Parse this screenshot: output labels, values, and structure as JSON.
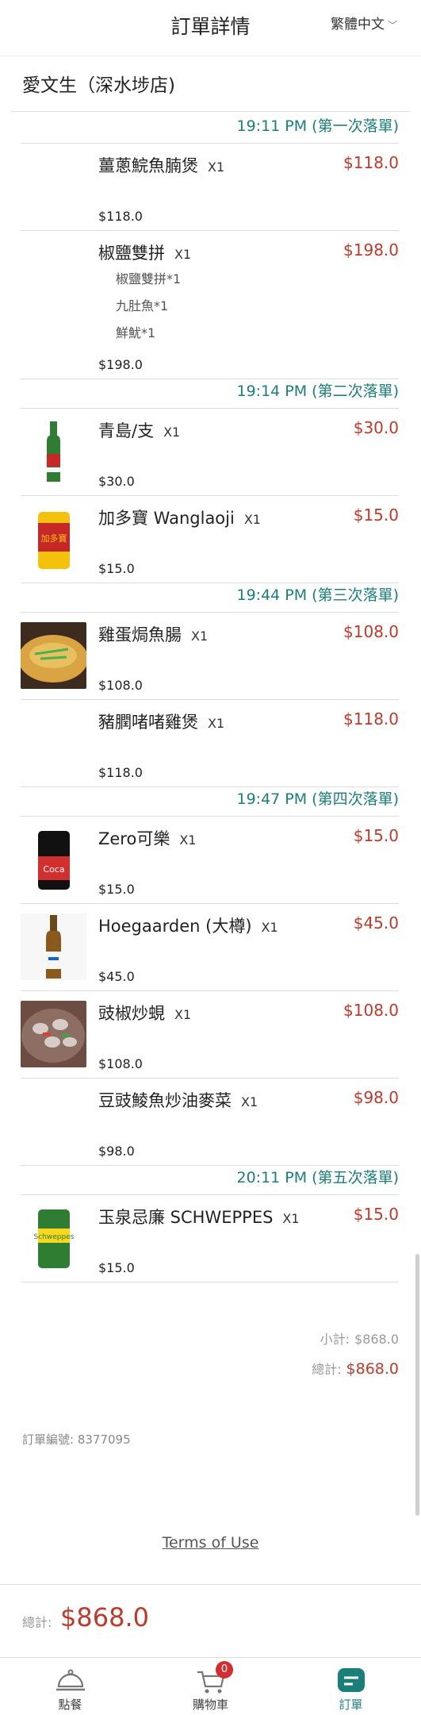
{
  "header": {
    "title": "訂單詳情",
    "language": "繁體中文"
  },
  "store": {
    "name": "愛文生（深水埗店)"
  },
  "rounds": [
    {
      "time": "19:11 PM (第一次落單)",
      "items": [
        {
          "name": "薑蔥鯇魚腩煲",
          "qty": "X1",
          "price": "$118.0",
          "subtotal": "$118.0",
          "image": "none",
          "options": []
        },
        {
          "name": "椒鹽雙拼",
          "qty": "X1",
          "price": "$198.0",
          "subtotal": "$198.0",
          "image": "none",
          "options": [
            "椒鹽雙拼*1",
            "九肚魚*1",
            "鮮魷*1"
          ]
        }
      ]
    },
    {
      "time": "19:14 PM (第二次落單)",
      "items": [
        {
          "name": "青島/支",
          "qty": "X1",
          "price": "$30.0",
          "subtotal": "$30.0",
          "image": "beer-bottle",
          "options": []
        },
        {
          "name": "加多寶 Wanglaoji",
          "qty": "X1",
          "price": "$15.0",
          "subtotal": "$15.0",
          "image": "yellow-can",
          "options": []
        }
      ]
    },
    {
      "time": "19:44 PM (第三次落單)",
      "items": [
        {
          "name": "雞蛋焗魚腸",
          "qty": "X1",
          "price": "$108.0",
          "subtotal": "$108.0",
          "image": "egg-dish",
          "options": []
        },
        {
          "name": "豬膶啫啫雞煲",
          "qty": "X1",
          "price": "$118.0",
          "subtotal": "$118.0",
          "image": "none",
          "options": []
        }
      ]
    },
    {
      "time": "19:47 PM (第四次落單)",
      "items": [
        {
          "name": "Zero可樂",
          "qty": "X1",
          "price": "$15.0",
          "subtotal": "$15.0",
          "image": "coke-zero-can",
          "options": []
        },
        {
          "name": "Hoegaarden (大樽)",
          "qty": "X1",
          "price": "$45.0",
          "subtotal": "$45.0",
          "image": "hoegaarden-bottle",
          "options": []
        },
        {
          "name": "豉椒炒蜆",
          "qty": "X1",
          "price": "$108.0",
          "subtotal": "$108.0",
          "image": "clam-dish",
          "options": []
        },
        {
          "name": "豆豉鯪魚炒油麥菜",
          "qty": "X1",
          "price": "$98.0",
          "subtotal": "$98.0",
          "image": "none",
          "options": []
        }
      ]
    },
    {
      "time": "20:11 PM (第五次落單)",
      "items": [
        {
          "name": "玉泉忌廉 SCHWEPPES",
          "qty": "X1",
          "price": "$15.0",
          "subtotal": "$15.0",
          "image": "schweppes-can",
          "options": []
        }
      ]
    }
  ],
  "summary": {
    "subtotal_label": "小計:",
    "subtotal": "$868.0",
    "total_label": "總計:",
    "total": "$868.0"
  },
  "order": {
    "number_label": "訂單編號:",
    "number": "8377095"
  },
  "terms": "Terms of Use",
  "footer": {
    "total_label": "總計:",
    "total": "$868.0"
  },
  "tabs": [
    {
      "label": "點餐",
      "icon": "cloche-icon"
    },
    {
      "label": "購物車",
      "icon": "cart-icon",
      "badge": "0"
    },
    {
      "label": "訂單",
      "icon": "order-icon",
      "active": true
    }
  ],
  "colors": {
    "accent": "#1b7f79",
    "price": "#c0392b",
    "badge": "#d32f2f"
  }
}
